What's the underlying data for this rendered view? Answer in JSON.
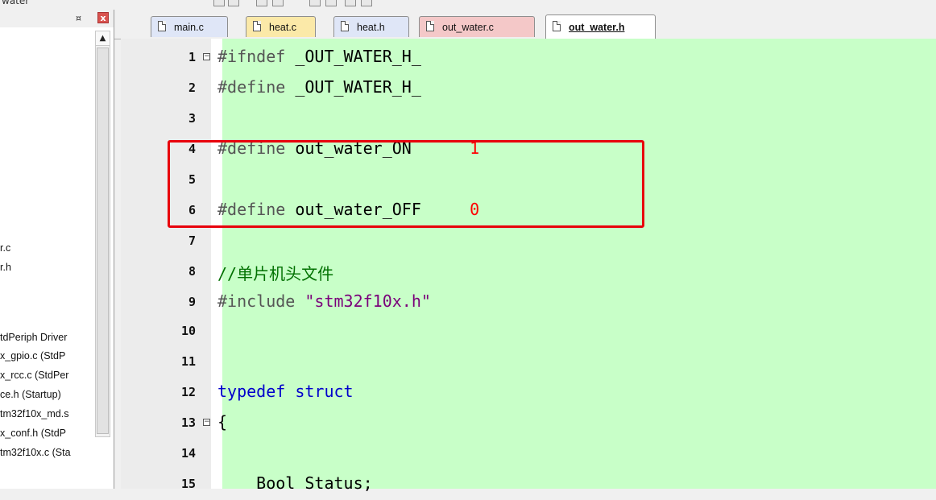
{
  "toolbar": {
    "text": "water"
  },
  "project_panel": {
    "pin_glyph": "¤",
    "close_glyph": "x",
    "scroll_up_glyph": "▲",
    "files": [
      "r.c",
      "r.h",
      "tdPeriph Driver",
      "x_gpio.c (StdP",
      "x_rcc.c (StdPer",
      "ce.h (Startup)",
      "tm32f10x_md.s",
      "x_conf.h (StdP",
      "tm32f10x.c (Sta"
    ]
  },
  "tabs": [
    {
      "label": "main.c"
    },
    {
      "label": "heat.c"
    },
    {
      "label": "heat.h"
    },
    {
      "label": "out_water.c"
    },
    {
      "label": "out_water.h",
      "active": true
    }
  ],
  "editor": {
    "background": "#c8ffc8",
    "lines": [
      {
        "no": "1",
        "fold": "−",
        "pp": "#ifndef",
        "rest": " _OUT_WATER_H_"
      },
      {
        "no": "2",
        "pp": "#define",
        "rest": " _OUT_WATER_H_"
      },
      {
        "no": "3"
      },
      {
        "no": "4",
        "pp": "#define",
        "rest": " out_water_ON      ",
        "num": "1"
      },
      {
        "no": "5"
      },
      {
        "no": "6",
        "pp": "#define",
        "rest": " out_water_OFF     ",
        "num": "0"
      },
      {
        "no": "7"
      },
      {
        "no": "8",
        "cmt": "//单片机头文件"
      },
      {
        "no": "9",
        "pp": "#include",
        "str": " \"stm32f10x.h\""
      },
      {
        "no": "10"
      },
      {
        "no": "11"
      },
      {
        "no": "12",
        "kw": "typedef struct"
      },
      {
        "no": "13",
        "fold": "−",
        "rest": "{"
      },
      {
        "no": "14"
      },
      {
        "no": "15",
        "rest": "    Bool Status;"
      }
    ]
  },
  "colors": {
    "highlight_box": "#e8000b",
    "number_literal": "#ff0000",
    "keyword": "#0000cc",
    "comment": "#007000"
  }
}
